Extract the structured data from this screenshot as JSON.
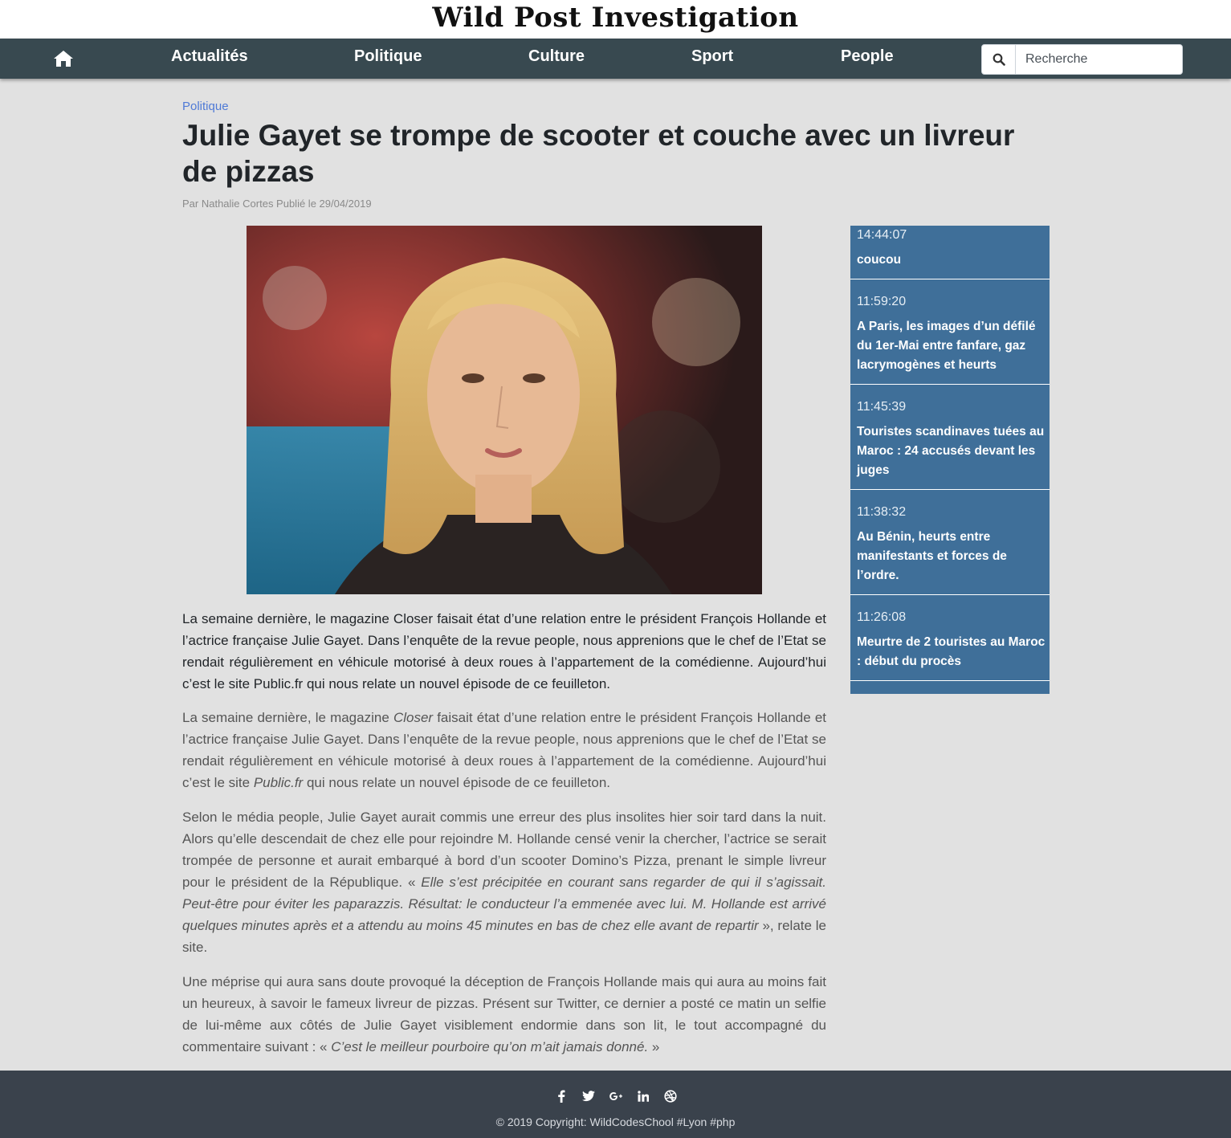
{
  "header": {
    "logo": "Wild Post Investigation"
  },
  "nav": {
    "items": [
      {
        "label": "Actualités"
      },
      {
        "label": "Politique"
      },
      {
        "label": "Culture"
      },
      {
        "label": "Sport"
      },
      {
        "label": "People"
      }
    ],
    "search_placeholder": "Recherche",
    "search_value": ""
  },
  "article": {
    "category": "Politique",
    "title": "Julie Gayet se trompe de scooter et couche avec un livreur de pizzas",
    "meta": "Par Nathalie Cortes Publié le 29/04/2019",
    "lead": "La semaine dernière, le magazine Closer faisait état d’une relation entre le président François Hollande et l’actrice française Julie Gayet. Dans l’enquête de la revue people, nous apprenions que le chef de l’Etat se rendait régulièrement en véhicule motorisé à deux roues à l’appartement de la comédienne. Aujourd’hui c’est le site Public.fr qui nous relate un nouvel épisode de ce feuilleton.",
    "p1": {
      "a": "La semaine dernière, le magazine ",
      "b": "Closer",
      "c": " faisait état d’une relation entre le président François Hollande et l’actrice française Julie Gayet. Dans l’enquête de la revue people, nous apprenions que le chef de l’Etat se rendait régulièrement en véhicule motorisé à deux roues à l’appartement de la comédienne. Aujourd’hui c’est le site ",
      "d": "Public.fr",
      "e": " qui nous relate un nouvel épisode de ce feuilleton."
    },
    "p2": {
      "a": "Selon le média people, Julie Gayet aurait commis une erreur des plus insolites hier soir tard dans la nuit. Alors qu’elle descendait de chez elle pour rejoindre M. Hollande censé venir la chercher, l’actrice se serait trompée de personne et aurait embarqué à bord d’un scooter Domino’s Pizza, prenant le simple livreur pour le président de la République. « ",
      "b": "Elle s’est précipitée en courant sans regarder de qui il s’agissait. Peut-être pour éviter les paparazzis. Résultat: le conducteur l’a emmenée avec lui. M. Hollande est arrivé quelques minutes après et a attendu au moins 45 minutes en bas de chez elle avant de repartir",
      "c": " », relate le site."
    },
    "p3": {
      "a": "Une méprise qui aura sans doute provoqué la déception de François Hollande mais qui aura au moins fait un heureux, à savoir le fameux livreur de pizzas. Présent sur Twitter, ce dernier a posté ce matin un selfie de lui-même aux côtés de Julie Gayet visiblement endormie dans son lit, le tout accompagné du commentaire suivant : « ",
      "b": "C’est le meilleur pourboire qu’on m’ait jamais donné.",
      "c": " »"
    }
  },
  "sidebar": {
    "items": [
      {
        "time": "14:44:07",
        "title": "coucou"
      },
      {
        "time": "11:59:20",
        "title": "A Paris, les images d’un défilé du 1er-Mai entre fanfare, gaz lacrymogènes et heurts"
      },
      {
        "time": "11:45:39",
        "title": "Touristes scandinaves tuées au Maroc : 24 accusés devant les juges"
      },
      {
        "time": "11:38:32",
        "title": "Au Bénin, heurts entre manifestants et forces de l’ordre."
      },
      {
        "time": "11:26:08",
        "title": "Meurtre de 2 touristes au Maroc : début du procès"
      }
    ]
  },
  "footer": {
    "icons": [
      "facebook-icon",
      "twitter-icon",
      "google-plus-icon",
      "linkedin-icon",
      "dribbble-icon"
    ],
    "copyright": "© 2019 Copyright: WildCodesChool #Lyon #php"
  },
  "colors": {
    "navbar": "#384950",
    "sidebar": "#3f6f99",
    "category_link": "#4f7ad6",
    "footer": "#3a424c",
    "background": "#e1e1e1"
  }
}
